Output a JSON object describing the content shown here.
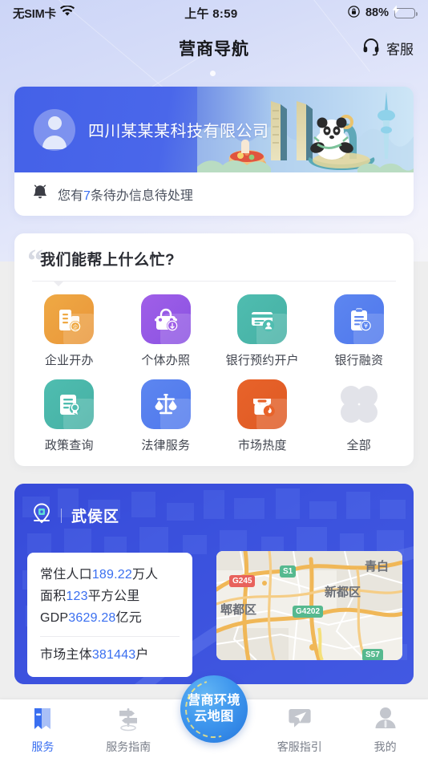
{
  "status_bar": {
    "carrier": "无SIM卡",
    "wifi_icon": "wifi-icon",
    "time": "上午 8:59",
    "lock_icon": "rotation-lock-icon",
    "battery_percent": "88%",
    "battery_level": 88,
    "charging": true
  },
  "header": {
    "title": "营商导航",
    "customer_service_label": "客服",
    "customer_service_icon": "headset-icon"
  },
  "company": {
    "avatar_icon": "user-avatar-icon",
    "name": "四川某某某科技有限公司",
    "todo_icon": "bell-icon",
    "todo_prefix": "您有",
    "todo_count": "7",
    "todo_suffix": "条待办信息待处理"
  },
  "help": {
    "quote_glyph": "“",
    "title": "我们能帮上什么忙?",
    "services": [
      {
        "label": "企业开办",
        "icon": "building-icon",
        "color": "#efa944",
        "color2": "#e9963a"
      },
      {
        "label": "个体办照",
        "icon": "briefcase-icon",
        "color": "#a05fe8",
        "color2": "#8a52e2"
      },
      {
        "label": "银行预约开户",
        "icon": "bank-card-icon",
        "color": "#4fbdb0",
        "color2": "#46b0a4"
      },
      {
        "label": "银行融资",
        "icon": "clipboard-yen-icon",
        "color": "#5d86f0",
        "color2": "#4f78ec"
      },
      {
        "label": "政策查询",
        "icon": "document-seal-icon",
        "color": "#4fbdb0",
        "color2": "#46b0a4"
      },
      {
        "label": "法律服务",
        "icon": "scales-icon",
        "color": "#5d86f0",
        "color2": "#4f78ec"
      },
      {
        "label": "市场热度",
        "icon": "shop-flame-icon",
        "color": "#e8632a",
        "color2": "#de5a24"
      },
      {
        "label": "全部",
        "icon": "grid-all-icon",
        "color": "#e2e3e9",
        "color2": "#e2e3e9"
      }
    ]
  },
  "district": {
    "pin_icon": "location-pin-icon",
    "name": "武侯区",
    "stats": [
      {
        "label": "常住人口",
        "value": "189.22",
        "unit": "万人"
      },
      {
        "label": "面积",
        "value": "123",
        "unit": "平方公里"
      },
      {
        "label": "GDP",
        "value": "3629.28",
        "unit": "亿元"
      }
    ],
    "stat_footer": {
      "label": "市场主体",
      "value": "381443",
      "unit": "户"
    },
    "map": {
      "road_labels": [
        {
          "text": "G245",
          "color": "#e8625c"
        },
        {
          "text": "S1",
          "color": "#56b98f"
        },
        {
          "text": "G4202",
          "color": "#56b98f"
        },
        {
          "text": "S57",
          "color": "#56b98f"
        }
      ],
      "area_labels": [
        "郫都区",
        "新都区",
        "青白"
      ]
    }
  },
  "tabbar": {
    "items": [
      {
        "label": "服务",
        "icon": "bookmark-icon",
        "active": true
      },
      {
        "label": "服务指南",
        "icon": "signpost-icon",
        "active": false
      },
      {
        "label": "客服指引",
        "icon": "send-chat-icon",
        "active": false
      },
      {
        "label": "我的",
        "icon": "person-icon",
        "active": false
      }
    ],
    "fab": {
      "line1": "营商环境",
      "line2": "云地图",
      "icon": "cloud-map-icon"
    }
  },
  "colors": {
    "accent_blue": "#3a6ff0",
    "card_blue": "#3d55e0",
    "page_bg": "#eeeeee"
  }
}
